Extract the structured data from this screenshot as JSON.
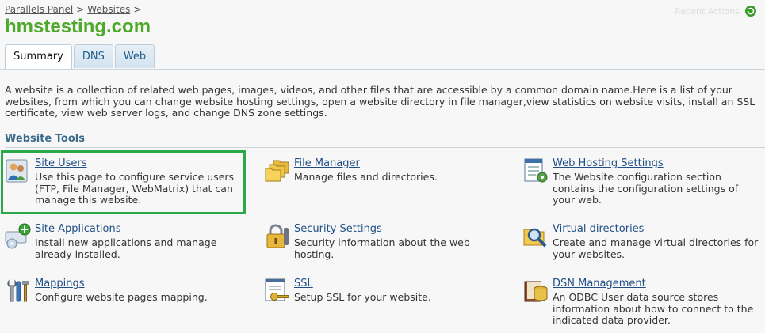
{
  "breadcrumb": {
    "items": [
      "Parallels Panel",
      "Websites"
    ],
    "separator": ">"
  },
  "corner_text": "Recent Actions",
  "title": "hmstesting.com",
  "tabs": [
    {
      "label": "Summary",
      "active": true
    },
    {
      "label": "DNS",
      "active": false
    },
    {
      "label": "Web",
      "active": false
    }
  ],
  "description": "A website is a collection of related web pages, images, videos, and other files that are accessible by a common domain name.Here is a list of your websites, from which you can change website hosting settings, open a website directory in file manager,view statistics on website visits, install an SSL certificate, view web server logs, and change DNS zone settings.",
  "section_title": "Website Tools",
  "tools": {
    "site_users": {
      "name": "Site Users",
      "desc": "Use this page to configure service users (FTP, File Manager, WebMatrix) that can manage this website.",
      "icon": "users-icon"
    },
    "file_manager": {
      "name": "File Manager",
      "desc": "Manage files and directories.",
      "icon": "folders-icon"
    },
    "web_hosting_settings": {
      "name": "Web Hosting Settings",
      "desc": "The Website configuration section contains the configuration settings of your web.",
      "icon": "settings-document-icon"
    },
    "site_applications": {
      "name": "Site Applications",
      "desc": "Install new applications and manage already installed.",
      "icon": "add-application-icon"
    },
    "security_settings": {
      "name": "Security Settings",
      "desc": "Security information about the web hosting.",
      "icon": "padlock-icon"
    },
    "virtual_directories": {
      "name": "Virtual directories",
      "desc": "Create and manage virtual directories for your websites.",
      "icon": "magnifier-folder-icon"
    },
    "mappings": {
      "name": "Mappings",
      "desc": "Configure website pages mapping.",
      "icon": "mapping-tools-icon"
    },
    "ssl": {
      "name": "SSL",
      "desc": "Setup SSL for your website.",
      "icon": "certificate-key-icon"
    },
    "dsn_management": {
      "name": "DSN Management",
      "desc": "An ODBC User data source stores information about how to connect to the indicated data provider.",
      "icon": "database-book-icon"
    }
  },
  "colors": {
    "title": "#4ea82a",
    "link": "#1f4f86",
    "highlight": "#2aa94a",
    "section": "#3c6a8a"
  }
}
